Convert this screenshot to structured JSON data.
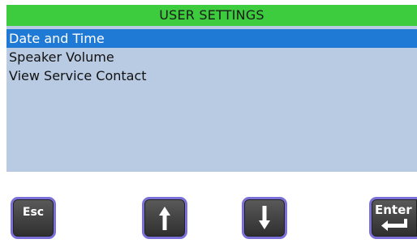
{
  "title": "USER SETTINGS",
  "colors": {
    "title_bar": "#3dcc3d",
    "panel": "#b9cae3",
    "selection": "#1f7ad6",
    "key_border": "#7b6fd8",
    "key_face": "#3a3a3a"
  },
  "menu": {
    "items": [
      {
        "label": "Date and Time",
        "selected": true
      },
      {
        "label": "Speaker Volume",
        "selected": false
      },
      {
        "label": "View Service Contact",
        "selected": false
      }
    ]
  },
  "softkeys": {
    "esc": {
      "label": "Esc",
      "icon": "none"
    },
    "up": {
      "label": "",
      "icon": "arrow-up-icon"
    },
    "down": {
      "label": "",
      "icon": "arrow-down-icon"
    },
    "enter": {
      "label": "Enter",
      "icon": "enter-return-icon"
    }
  }
}
